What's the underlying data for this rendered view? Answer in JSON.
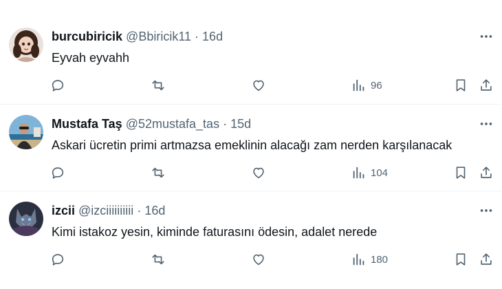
{
  "tweets": [
    {
      "name": "burcubiricik",
      "handle": "@Bbiricik11",
      "separator": "·",
      "time": "16d",
      "text": "Eyvah eyvahh",
      "views": "96",
      "avatar_icon": "avatar-doll-portrait"
    },
    {
      "name": "Mustafa Taş",
      "handle": "@52mustafa_tas",
      "separator": "·",
      "time": "15d",
      "text": "Askari ücretin primi artmazsa emeklinin alacağı zam nerden karşılanacak",
      "views": "104",
      "avatar_icon": "avatar-man-seaside"
    },
    {
      "name": "izcii",
      "handle": "@izciiiiiiiiii",
      "separator": "·",
      "time": "16d",
      "text": "Kimi istakoz yesin, kiminde faturasını ödesin, adalet nerede",
      "views": "180",
      "avatar_icon": "avatar-wolf"
    }
  ],
  "icons": {
    "more": "more-horizontal-icon",
    "reply": "reply-icon",
    "retweet": "retweet-icon",
    "like": "heart-icon",
    "views": "views-chart-icon",
    "bookmark": "bookmark-icon",
    "share": "share-icon"
  },
  "colors": {
    "text_primary": "#0f1419",
    "text_secondary": "#536471",
    "divider": "#eff3f4"
  }
}
